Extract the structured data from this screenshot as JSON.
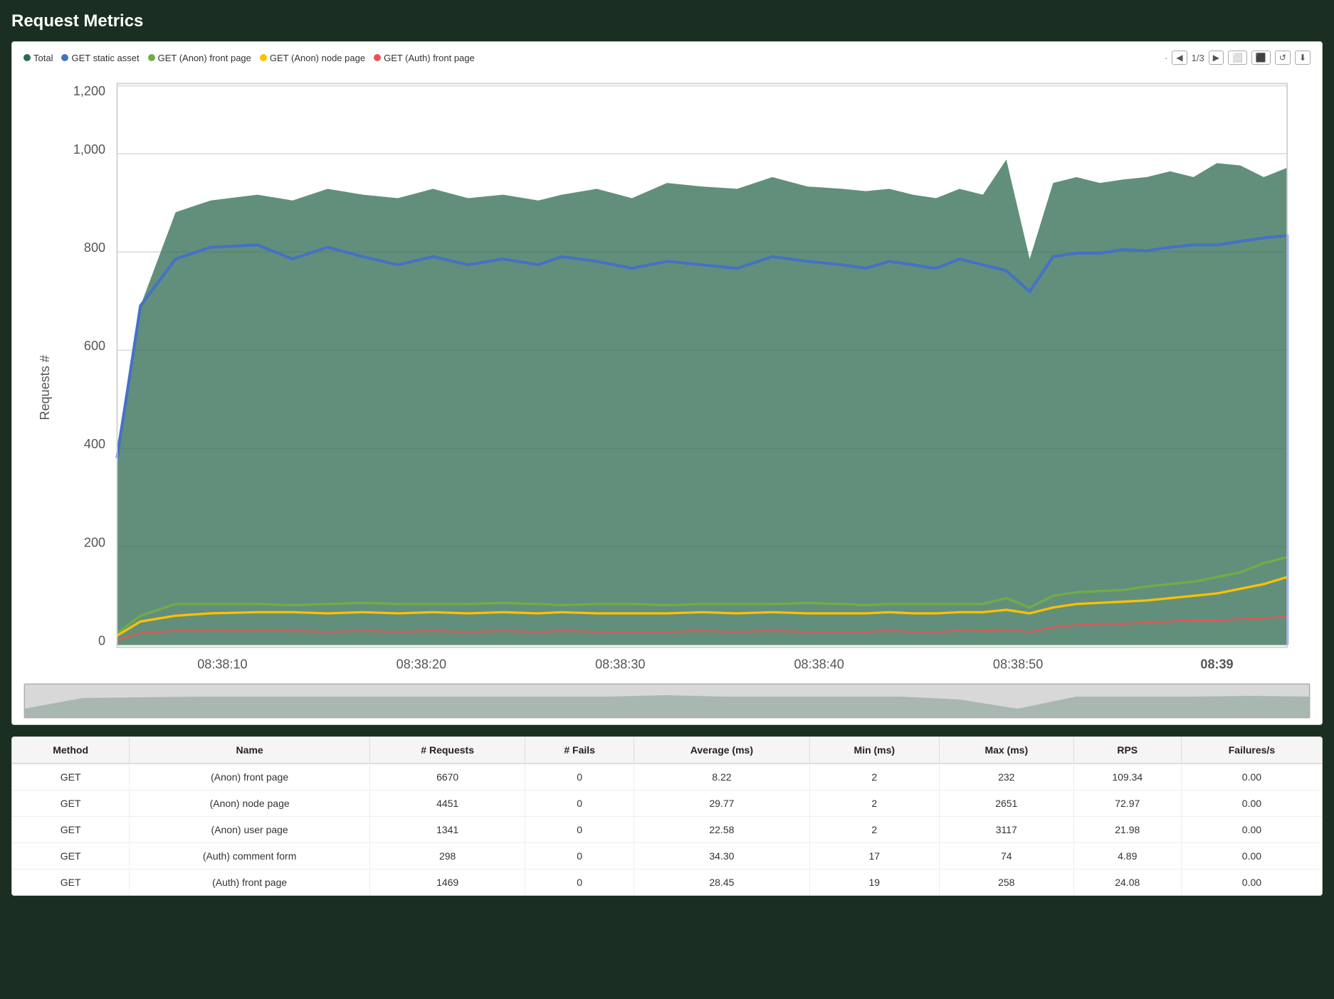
{
  "page": {
    "title": "Request Metrics"
  },
  "legend": {
    "items": [
      {
        "id": "total",
        "label": "Total",
        "color": "#2d6a4f",
        "type": "area"
      },
      {
        "id": "get-static",
        "label": "GET static asset",
        "color": "#4472c4",
        "type": "line"
      },
      {
        "id": "get-anon-front",
        "label": "GET (Anon) front page",
        "color": "#70ad47",
        "type": "line"
      },
      {
        "id": "get-anon-node",
        "label": "GET (Anon) node page",
        "color": "#ffc000",
        "type": "line"
      },
      {
        "id": "get-auth-front",
        "label": "GET (Auth) front page",
        "color": "#e15759",
        "type": "line"
      }
    ],
    "page": "1/3"
  },
  "chart": {
    "y_axis_title": "Requests #",
    "y_ticks": [
      "0",
      "200",
      "400",
      "600",
      "800",
      "1,000",
      "1,200"
    ],
    "x_ticks": [
      "08:38:10",
      "08:38:20",
      "08:38:30",
      "08:38:40",
      "08:38:50",
      "08:39"
    ]
  },
  "table": {
    "headers": [
      "Method",
      "Name",
      "# Requests",
      "# Fails",
      "Average (ms)",
      "Min (ms)",
      "Max (ms)",
      "RPS",
      "Failures/s"
    ],
    "rows": [
      {
        "method": "GET",
        "name": "(Anon) front page",
        "requests": "6670",
        "fails": "0",
        "avg_ms": "8.22",
        "min_ms": "2",
        "max_ms": "232",
        "rps": "109.34",
        "failures_s": "0.00"
      },
      {
        "method": "GET",
        "name": "(Anon) node page",
        "requests": "4451",
        "fails": "0",
        "avg_ms": "29.77",
        "min_ms": "2",
        "max_ms": "2651",
        "rps": "72.97",
        "failures_s": "0.00"
      },
      {
        "method": "GET",
        "name": "(Anon) user page",
        "requests": "1341",
        "fails": "0",
        "avg_ms": "22.58",
        "min_ms": "2",
        "max_ms": "3117",
        "rps": "21.98",
        "failures_s": "0.00"
      },
      {
        "method": "GET",
        "name": "(Auth) comment form",
        "requests": "298",
        "fails": "0",
        "avg_ms": "34.30",
        "min_ms": "17",
        "max_ms": "74",
        "rps": "4.89",
        "failures_s": "0.00"
      },
      {
        "method": "GET",
        "name": "(Auth) front page",
        "requests": "1469",
        "fails": "0",
        "avg_ms": "28.45",
        "min_ms": "19",
        "max_ms": "258",
        "rps": "24.08",
        "failures_s": "0.00"
      }
    ]
  },
  "controls": {
    "prev_label": "◀",
    "next_label": "▶",
    "icon_expand": "⬜",
    "icon_collapse": "⬛",
    "icon_refresh": "↺",
    "icon_download": "⬇"
  }
}
